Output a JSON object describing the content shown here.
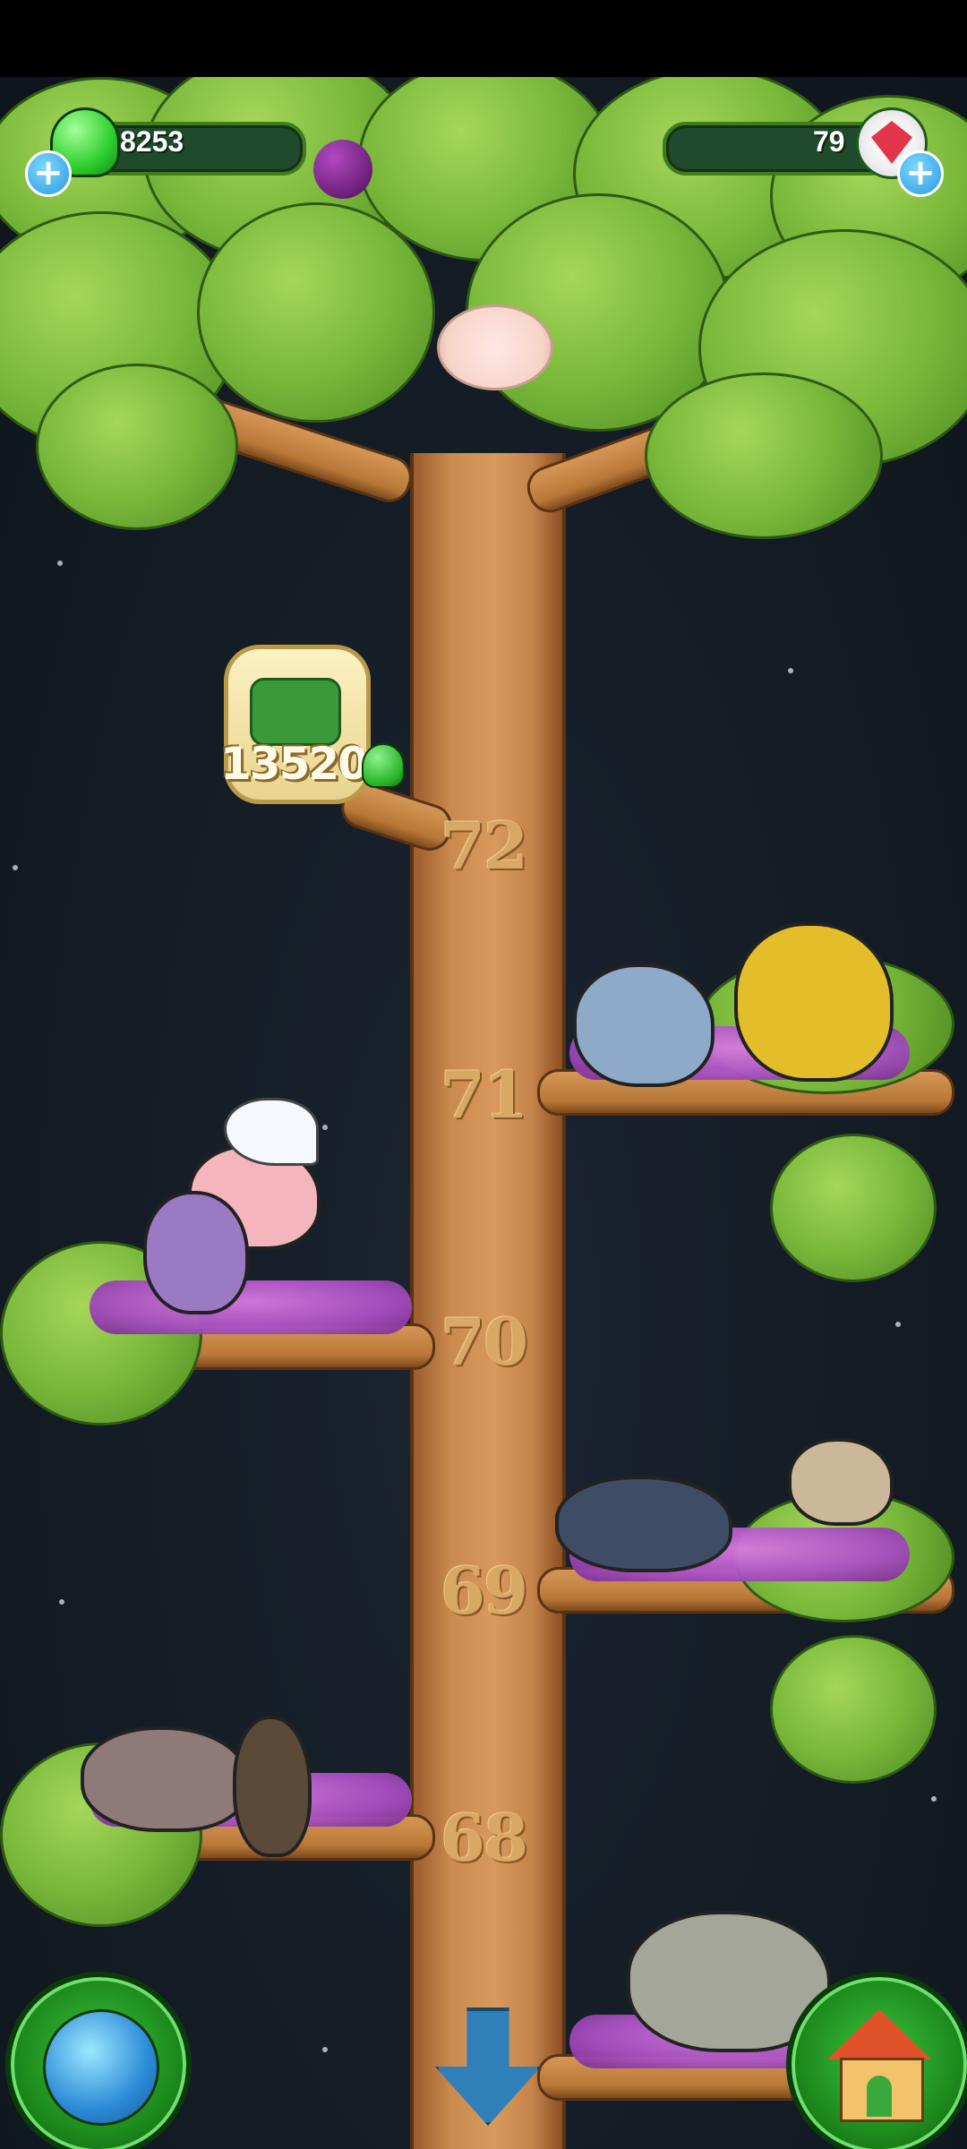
{
  "hud": {
    "currency_left": "8253",
    "currency_right": "79"
  },
  "tree": {
    "levels": [
      "72",
      "71",
      "70",
      "69",
      "68"
    ]
  },
  "upgrade": {
    "cost": "13520"
  },
  "colors": {
    "hud_green": "#1f4a2c",
    "gem_red": "#e0354a",
    "platform_purple": "#a84fc2",
    "wood": "#c98a4e"
  },
  "icons": {
    "left_currency": "green-jelly-icon",
    "right_currency": "red-gem-icon",
    "upgrade": "watering-can-icon",
    "nav_left": "globe-icon",
    "nav_center": "down-arrow-icon",
    "nav_right": "house-icon"
  }
}
